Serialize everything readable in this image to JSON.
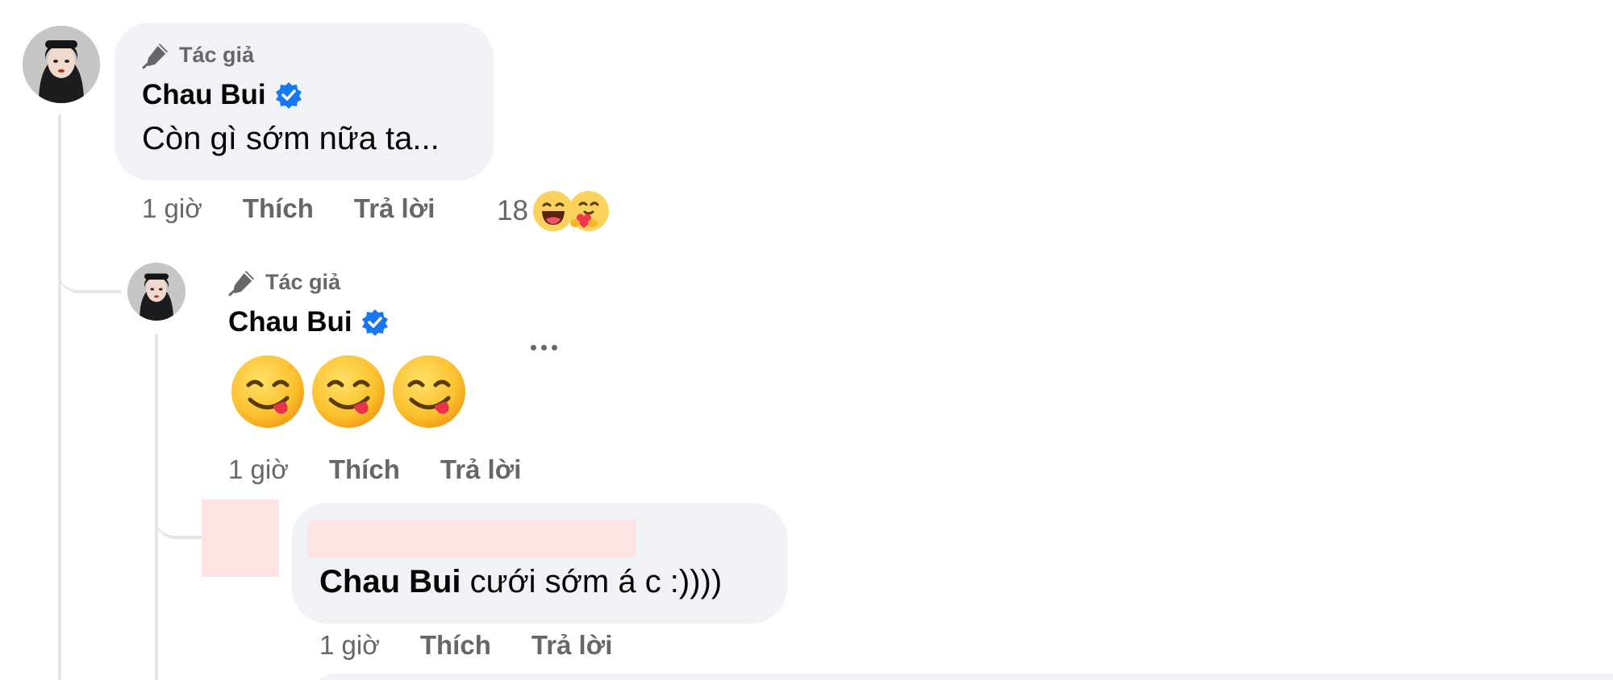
{
  "comments": [
    {
      "badge": "Tác giả",
      "author": "Chau Bui",
      "text": "Còn gì sớm nữa ta...",
      "time": "1 giờ",
      "like_label": "Thích",
      "reply_label": "Trả lời",
      "reaction_count": "18",
      "reactions": [
        "haha-icon",
        "care-icon"
      ]
    },
    {
      "badge": "Tác giả",
      "author": "Chau Bui",
      "emojis": [
        "yum-face-icon",
        "yum-face-icon",
        "yum-face-icon"
      ],
      "time": "1 giờ",
      "like_label": "Thích",
      "reply_label": "Trả lời",
      "more_icon": "more-dots-icon"
    },
    {
      "mention": "Chau Bui",
      "text": " cưới sớm á c :))))",
      "time": "1 giờ",
      "like_label": "Thích",
      "reply_label": "Trả lời"
    }
  ],
  "colors": {
    "bubble": "#f0f2f5",
    "meta_text": "#65676b",
    "verified_blue": "#1877f2",
    "thread_line": "#e4e6eb",
    "redaction": "#fde3e3"
  }
}
